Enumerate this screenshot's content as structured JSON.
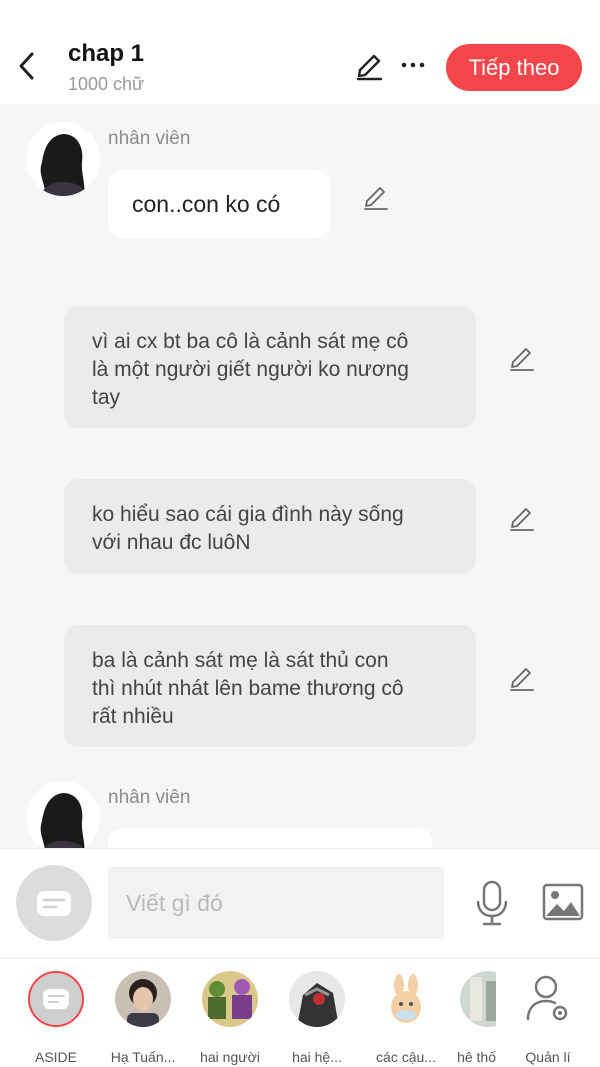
{
  "header": {
    "title": "chap 1",
    "subtitle": "1000 chữ",
    "next_label": "Tiếp theo"
  },
  "messages": [
    {
      "type": "character",
      "speaker": "nhân viên",
      "text": "con..con ko có"
    },
    {
      "type": "narration",
      "lines": [
        "vì ai cx bt ba cô là cảnh sát mẹ cô",
        "là một người giết người ko nương",
        "tay"
      ]
    },
    {
      "type": "narration",
      "lines": [
        "ko hiểu sao cái gia đình này sống",
        "với nhau đc luôN"
      ]
    },
    {
      "type": "narration",
      "lines": [
        "ba là cảnh sát mẹ là sát thủ con",
        "thì nhút nhát lên bame thương cô",
        "rất nhiều"
      ]
    },
    {
      "type": "character",
      "speaker": "nhân viên",
      "text": ""
    }
  ],
  "composer": {
    "placeholder": "Viết gì đó"
  },
  "characters": [
    {
      "label": "ASIDE"
    },
    {
      "label": "Hạ Tuấn..."
    },
    {
      "label": "hai người"
    },
    {
      "label": "hai hệ..."
    },
    {
      "label": "các cậu..."
    },
    {
      "label": "hệ thố"
    },
    {
      "label": "Quản lí"
    }
  ],
  "colors": {
    "accent": "#f2464a",
    "background": "#f6f6f6",
    "narration_bubble": "#ebebeb"
  }
}
